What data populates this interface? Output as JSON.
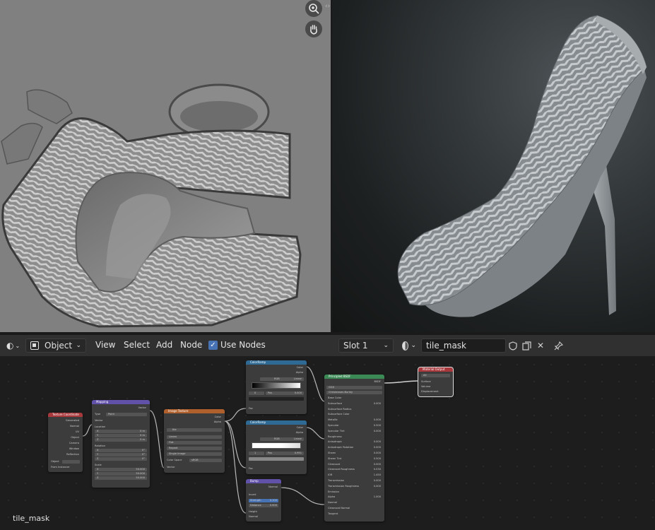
{
  "node_editor_header": {
    "object_mode": "Object",
    "menus": [
      "View",
      "Select",
      "Add",
      "Node"
    ],
    "use_nodes_label": "Use Nodes",
    "slot": "Slot 1",
    "material_name": "tile_mask"
  },
  "node_tree_name": "tile_mask",
  "nodes": {
    "tex_coord": {
      "title": "Texture Coordinate",
      "outputs": [
        "Generated",
        "Normal",
        "UV",
        "Object",
        "Camera",
        "Window",
        "Reflection"
      ],
      "object_label": "Object",
      "from_instancer": "From Instancer"
    },
    "mapping": {
      "title": "Mapping",
      "output": "Vector",
      "type_label": "Type",
      "type_value": "Point",
      "vector_label": "Vector",
      "location_label": "Location",
      "rotation_label": "Rotation",
      "scale_label": "Scale",
      "axes": [
        "X",
        "Y",
        "Z"
      ],
      "location": [
        "0 m",
        "0 m",
        "0 m"
      ],
      "rotation": [
        "0°",
        "0°",
        "0°"
      ],
      "scale": [
        "50.000",
        "50.000",
        "50.000"
      ]
    },
    "image": {
      "title": "Image Texture",
      "outputs": [
        "Color",
        "Alpha"
      ],
      "image_name": "tile",
      "options": [
        "Linear",
        "Flat",
        "Repeat",
        "Single Image"
      ],
      "color_space_label": "Color Space",
      "color_space": "sRGB",
      "vector_label": "Vector"
    },
    "ramp1": {
      "title": "ColorRamp",
      "outputs": [
        "Color",
        "Alpha"
      ],
      "mode": "RGB",
      "interp": "Linear",
      "index": "0",
      "pos_label": "Pos",
      "pos": "0.000",
      "fac": "Fac"
    },
    "ramp2": {
      "title": "ColorRamp",
      "outputs": [
        "Color",
        "Alpha"
      ],
      "mode": "RGB",
      "interp": "Linear",
      "index": "1",
      "pos_label": "Pos",
      "pos": "0.991",
      "fac": "Fac"
    },
    "bump": {
      "title": "Bump",
      "output": "Normal",
      "invert": "Invert",
      "strength_label": "Strength",
      "strength": "0.100",
      "distance_label": "Distance",
      "distance": "0.900",
      "inputs": [
        "Height",
        "Normal"
      ]
    },
    "principled": {
      "title": "Principled BSDF",
      "output": "BSDF",
      "distribution": "GGX",
      "subsurface_method": "Christensen-Burley",
      "rows": [
        {
          "label": "Base Color",
          "value": ""
        },
        {
          "label": "Subsurface",
          "value": "0.000"
        },
        {
          "label": "Subsurface Radius",
          "value": ""
        },
        {
          "label": "Subsurface Color",
          "value": ""
        },
        {
          "label": "Metallic",
          "value": "0.000"
        },
        {
          "label": "Specular",
          "value": "0.500"
        },
        {
          "label": "Specular Tint",
          "value": "0.000"
        },
        {
          "label": "Roughness",
          "value": ""
        },
        {
          "label": "Anisotropic",
          "value": "0.000"
        },
        {
          "label": "Anisotropic Rotation",
          "value": "0.000"
        },
        {
          "label": "Sheen",
          "value": "0.000"
        },
        {
          "label": "Sheen Tint",
          "value": "0.500"
        },
        {
          "label": "Clearcoat",
          "value": "0.000"
        },
        {
          "label": "Clearcoat Roughness",
          "value": "0.030"
        },
        {
          "label": "IOR",
          "value": "1.450"
        },
        {
          "label": "Transmission",
          "value": "0.000"
        },
        {
          "label": "Transmission Roughness",
          "value": "0.000"
        },
        {
          "label": "Emission",
          "value": ""
        },
        {
          "label": "Alpha",
          "value": "1.000"
        },
        {
          "label": "Normal",
          "value": ""
        },
        {
          "label": "Clearcoat Normal",
          "value": ""
        },
        {
          "label": "Tangent",
          "value": ""
        }
      ]
    },
    "output": {
      "title": "Material Output",
      "target": "All",
      "inputs": [
        "Surface",
        "Volume",
        "Displacement"
      ]
    }
  },
  "colors": {
    "accent": "#4772b3",
    "header_bg": "#303030",
    "editor_bg": "#1d1d1d",
    "uv_bg": "#808080",
    "node_output_red": "#a8383c",
    "node_shader_green": "#3b8a56",
    "node_vector_purple": "#6251a8",
    "node_texture_orange": "#b0602d",
    "node_converter_blue": "#2f6a94"
  },
  "icons": [
    "zoom-in-icon",
    "pan-hand-icon",
    "view-toggle-icon",
    "editor-type-icon",
    "object-mode-icon",
    "checkbox-icon",
    "material-sphere-icon",
    "fake-user-shield-icon",
    "duplicate-icon",
    "close-icon",
    "pin-icon"
  ]
}
